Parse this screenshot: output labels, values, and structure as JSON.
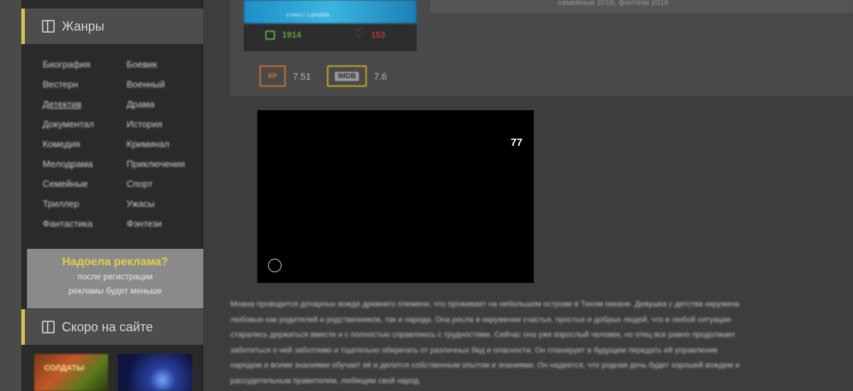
{
  "sidebar": {
    "genres_header": "Жанры",
    "genres": [
      "Биография",
      "Боевик",
      "Вестерн",
      "Военный",
      "Детектив",
      "Драма",
      "Документал",
      "История",
      "Комедия",
      "Криминал",
      "Мелодрама",
      "Приключения",
      "Семейные",
      "Спорт",
      "Триллер",
      "Ужасы",
      "Фантастика",
      "Фэнтези"
    ],
    "ads": {
      "title": "Надоела реклама?",
      "line1": "после регистрации",
      "line2": "рекламы будет меньше"
    },
    "soon_header": "Скоро на сайте",
    "soon_thumb1_text": "СОЛДАТЫ"
  },
  "movie": {
    "poster_caption": "в кино с 1 декабря",
    "likes": "1914",
    "dislikes": "153",
    "info_line": "семейные 2016,   фэнтези 2016",
    "kp_label": "КР",
    "kp_rating": "7.51",
    "imdb_label": "IMDB",
    "imdb_rating": "7.6"
  },
  "player": {
    "badge_number": "77"
  },
  "description": [
    "Моана проводится дочарных вождя древнего племени, что проживает на небольшом острове в Тихом океане. Девушка с детства окружена",
    "любовью как родителей и родственников, так и народа. Она росла в окружении счастья, простых и добрых людей, что в любой ситуации",
    "старались держаться вместе и с полностью справляюсь с трудностями. Сейчас она уже взрослый человек, но отец все равно продолжает",
    "заботиться о ней заботливо и тщательно оберегать от различных бед и опасности. Он планирует в будущем передать ей управление",
    "народом и всеми знаниями обучает её и делится собственным опытом и знаниями. Он надеется, что родная дочь будет хорошей вождем и",
    "рассудительным правителем, любящим свой народ."
  ]
}
